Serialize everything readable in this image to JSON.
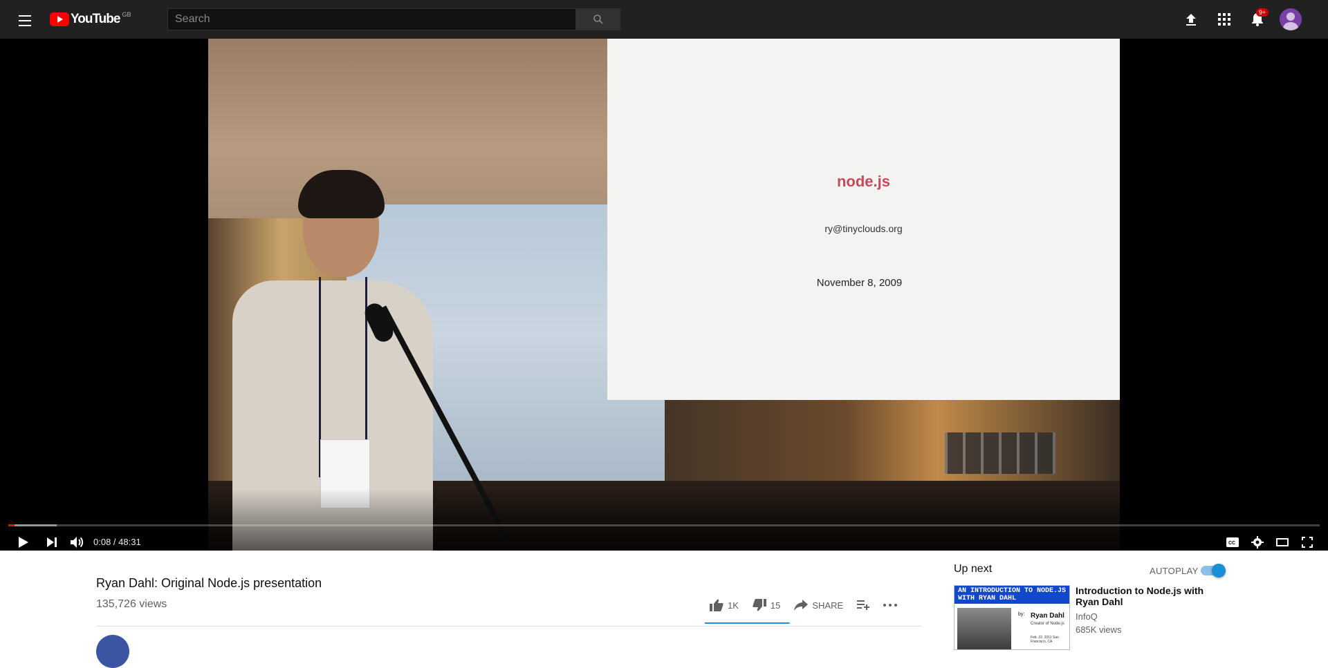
{
  "masthead": {
    "logo_text": "YouTube",
    "region": "GB",
    "search_placeholder": "Search",
    "notifications_badge": "9+"
  },
  "player": {
    "slide": {
      "title": "node.js",
      "email": "ry@tinyclouds.org",
      "date": "November 8, 2009"
    },
    "time_current": "0:08",
    "time_separator": " / ",
    "time_total": "48:31",
    "progress_played_fraction": 0.005,
    "progress_loaded_fraction": 0.037,
    "colors": {
      "progress": "#ff0000"
    }
  },
  "video": {
    "title": "Ryan Dahl: Original Node.js presentation",
    "views": "135,726 views",
    "likes": "1K",
    "dislikes": "15",
    "share_label": "SHARE",
    "like_fraction": 0.985
  },
  "sidebar": {
    "up_next_label": "Up next",
    "autoplay_label": "AUTOPLAY",
    "autoplay_on": true,
    "recommendation": {
      "title": "Introduction to Node.js with Ryan Dahl",
      "channel": "InfoQ",
      "views": "685K views",
      "thumbnail_banner": "AN INTRODUCTION TO NODE.JS WITH RYAN DAHL",
      "thumbnail_by": "by:",
      "thumbnail_name": "Ryan Dahl",
      "thumbnail_sub": "Creator of Node.js",
      "thumbnail_date": "Feb. 22, 2011 San Francisco, CA"
    }
  },
  "icons": [
    "menu-icon",
    "search-icon",
    "upload-icon",
    "apps-icon",
    "bell-icon",
    "play-icon",
    "next-icon",
    "volume-icon",
    "captions-icon",
    "settings-icon",
    "theater-icon",
    "fullscreen-icon",
    "thumbs-up-icon",
    "thumbs-down-icon",
    "share-icon",
    "add-to-playlist-icon",
    "more-icon"
  ]
}
